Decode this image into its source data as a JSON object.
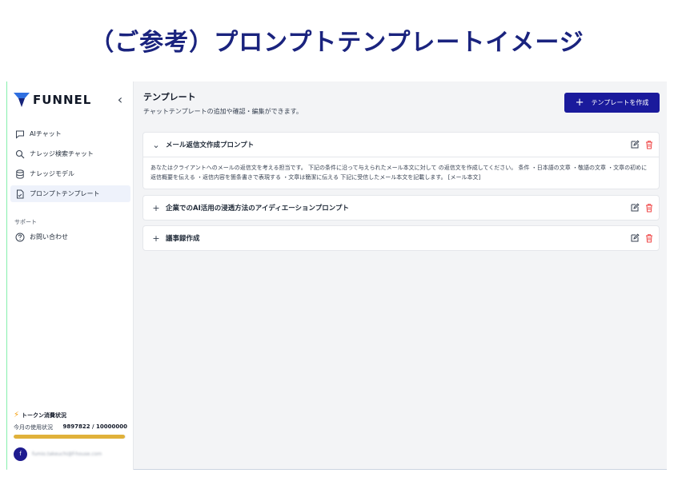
{
  "headline": "（ご参考）プロンプトテンプレートイメージ",
  "app": {
    "name": "FUNNEL"
  },
  "sidebar": {
    "collapse_glyph": "‹",
    "nav": [
      {
        "label": "AIチャット",
        "icon": "chat-bubble-icon",
        "active": false
      },
      {
        "label": "ナレッジ検索チャット",
        "icon": "search-icon",
        "active": false
      },
      {
        "label": "ナレッジモデル",
        "icon": "database-icon",
        "active": false
      },
      {
        "label": "プロンプトテンプレート",
        "icon": "document-icon",
        "active": true
      }
    ],
    "support_label": "サポート",
    "support_items": [
      {
        "label": "お問い合わせ",
        "icon": "help-circle-icon"
      }
    ],
    "token": {
      "title": "トークン消費状況",
      "usage_label": "今月の使用状況",
      "usage_value": "9897822 / 10000000",
      "usage_fraction": 0.9898
    },
    "user": {
      "avatar_letter": "f",
      "email": "fumio.takeuchi@f-house.com"
    }
  },
  "main": {
    "title": "テンプレート",
    "subtitle": "チャットテンプレートの追加や確認・編集ができます。",
    "create_button": "テンプレートを作成",
    "templates": [
      {
        "name": "メール返信文作成プロンプト",
        "expanded": true,
        "toggle": "⌄",
        "body": "あなたはクライアントへのメールの返信文を考える担当です。 下記の条件に沿って与えられたメール本文に対して の返信文を作成してください。 条件 ・日本語の文章 ・敬語の文章 ・文章の初めに返信概要を伝える ・返信内容を箇条書きで表現する ・文章は簡潔に伝える 下記に受信したメール本文を記載します。 [メール本文]"
      },
      {
        "name": "企業でのAI活用の浸透方法のアイディエーションプロンプト",
        "expanded": false,
        "toggle": "+",
        "body": ""
      },
      {
        "name": "議事録作成",
        "expanded": false,
        "toggle": "+",
        "body": ""
      }
    ]
  },
  "colors": {
    "brand": "#1a1a9c",
    "headline": "#1a237e",
    "logo_blue": "#2f6fe0",
    "logo_navy": "#16237a",
    "token_fill": "#e0b13a",
    "delete": "#ef4444"
  }
}
